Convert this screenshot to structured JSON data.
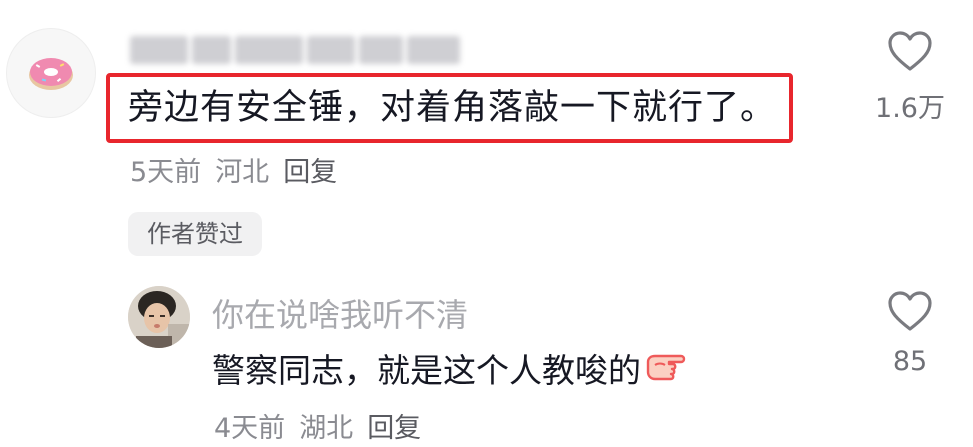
{
  "main_comment": {
    "text": "旁边有安全锤，对着角落敲一下就行了。",
    "time": "5天前",
    "location": "河北",
    "reply_label": "回复",
    "author_badge": "作者赞过",
    "likes": "1.6万",
    "avatar_icon": "donut-icon"
  },
  "reply_comment": {
    "username": "你在说啥我听不清",
    "text": "警察同志，就是这个人教唆的",
    "emoji_icon": "pointing-hand-icon",
    "time": "4天前",
    "location": "湖北",
    "reply_label": "回复",
    "likes": "85"
  },
  "colors": {
    "highlight_border": "#e8262d",
    "text_primary": "#161823",
    "text_secondary": "#8a8b91"
  }
}
